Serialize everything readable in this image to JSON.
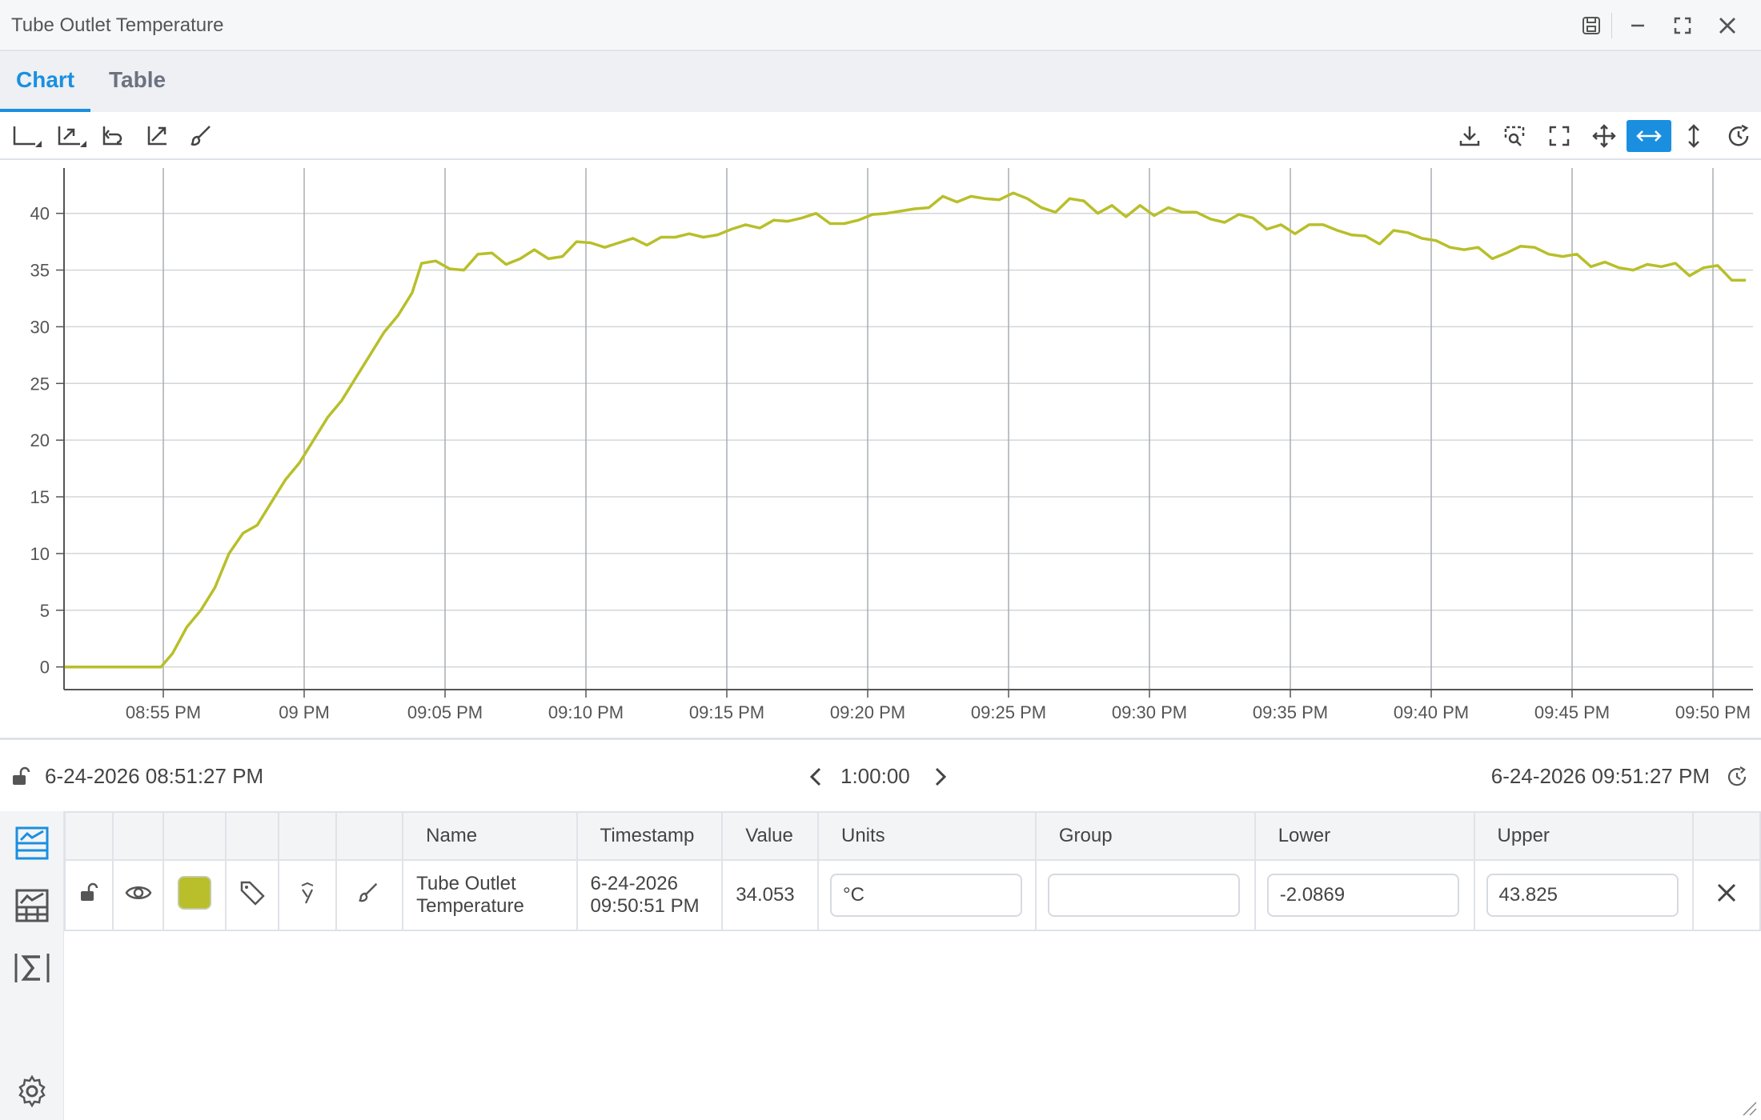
{
  "window": {
    "title": "Tube Outlet Temperature",
    "icons": [
      "save-icon",
      "minimize-icon",
      "maximize-icon",
      "close-icon"
    ]
  },
  "tabs": [
    {
      "label": "Chart",
      "active": true
    },
    {
      "label": "Table",
      "active": false
    }
  ],
  "toolbar": {
    "left_icons": [
      "axis-icon",
      "axis-scale-icon",
      "undo-zoom-icon",
      "autoscale-icon",
      "brush-icon"
    ],
    "right_icons": [
      "download-icon",
      "zoom-select-icon",
      "fullscreen-icon",
      "pan-icon",
      "horizontal-zoom-icon",
      "vertical-zoom-icon",
      "history-icon"
    ],
    "active_icon": "horizontal-zoom-icon"
  },
  "chart_data": {
    "type": "line",
    "title": "",
    "xlabel": "",
    "ylabel": "",
    "ylim": [
      -2,
      44
    ],
    "yticks": [
      0,
      5,
      10,
      15,
      20,
      25,
      30,
      35,
      40
    ],
    "xticks": [
      "08:55 PM",
      "09 PM",
      "09:05 PM",
      "09:10 PM",
      "09:15 PM",
      "09:20 PM",
      "09:25 PM",
      "09:30 PM",
      "09:35 PM",
      "09:40 PM",
      "09:45 PM",
      "09:50 PM"
    ],
    "grid": true,
    "color": "#b8bf2a",
    "series": [
      {
        "x": [
          "08:51:30 PM",
          "08:52 PM",
          "08:53 PM",
          "08:54 PM",
          "08:54:55 PM",
          "08:55:20 PM",
          "08:55:50 PM",
          "08:56:20 PM",
          "08:56:50 PM",
          "08:57:20 PM",
          "08:57:50 PM",
          "08:58:20 PM",
          "08:58:50 PM",
          "08:59:20 PM",
          "08:59:50 PM",
          "09:00:20 PM",
          "09:00:50 PM",
          "09:01:20 PM",
          "09:01:50 PM",
          "09:02:20 PM",
          "09:02:50 PM",
          "09:03:20 PM",
          "09:03:50 PM",
          "09:04:10 PM",
          "09:04:40 PM",
          "09:05:10 PM",
          "09:05:40 PM",
          "09:06:10 PM",
          "09:06:40 PM",
          "09:07:10 PM",
          "09:07:40 PM",
          "09:08:10 PM",
          "09:08:40 PM",
          "09:09:10 PM",
          "09:09:40 PM",
          "09:10:10 PM",
          "09:10:40 PM",
          "09:11:10 PM",
          "09:11:40 PM",
          "09:12:10 PM",
          "09:12:40 PM",
          "09:13:10 PM",
          "09:13:40 PM",
          "09:14:10 PM",
          "09:14:40 PM",
          "09:15:10 PM",
          "09:15:40 PM",
          "09:16:10 PM",
          "09:16:40 PM",
          "09:17:10 PM",
          "09:17:40 PM",
          "09:18:10 PM",
          "09:18:40 PM",
          "09:19:10 PM",
          "09:19:40 PM",
          "09:20:10 PM",
          "09:20:40 PM",
          "09:21:10 PM",
          "09:21:40 PM",
          "09:22:10 PM",
          "09:22:40 PM",
          "09:23:10 PM",
          "09:23:40 PM",
          "09:24:10 PM",
          "09:24:40 PM",
          "09:25:10 PM",
          "09:25:40 PM",
          "09:26:10 PM",
          "09:26:40 PM",
          "09:27:10 PM",
          "09:27:40 PM",
          "09:28:10 PM",
          "09:28:40 PM",
          "09:29:10 PM",
          "09:29:40 PM",
          "09:30:10 PM",
          "09:30:40 PM",
          "09:31:10 PM",
          "09:31:40 PM",
          "09:32:10 PM",
          "09:32:40 PM",
          "09:33:10 PM",
          "09:33:40 PM",
          "09:34:10 PM",
          "09:34:40 PM",
          "09:35:10 PM",
          "09:35:40 PM",
          "09:36:10 PM",
          "09:36:40 PM",
          "09:37:10 PM",
          "09:37:40 PM",
          "09:38:10 PM",
          "09:38:40 PM",
          "09:39:10 PM",
          "09:39:40 PM",
          "09:40:10 PM",
          "09:40:40 PM",
          "09:41:10 PM",
          "09:41:40 PM",
          "09:42:10 PM",
          "09:42:40 PM",
          "09:43:10 PM",
          "09:43:40 PM",
          "09:44:10 PM",
          "09:44:40 PM",
          "09:45:10 PM",
          "09:45:40 PM",
          "09:46:10 PM",
          "09:46:40 PM",
          "09:47:10 PM",
          "09:47:40 PM",
          "09:48:10 PM",
          "09:48:40 PM",
          "09:49:10 PM",
          "09:49:40 PM",
          "09:50:10 PM",
          "09:50:40 PM",
          "09:51:10 PM"
        ],
        "values": [
          0,
          0,
          0,
          0,
          0,
          1.2,
          3.5,
          5,
          7,
          10,
          11.8,
          12.5,
          14.5,
          16.5,
          18,
          20,
          22,
          23.5,
          25.5,
          27.5,
          29.5,
          31,
          33,
          35.6,
          35.8,
          35.1,
          35,
          36.4,
          36.5,
          35.5,
          36,
          36.8,
          36,
          36.2,
          37.5,
          37.4,
          37,
          37.4,
          37.8,
          37.2,
          37.9,
          37.9,
          38.2,
          37.9,
          38.1,
          38.6,
          39,
          38.7,
          39.4,
          39.3,
          39.6,
          40,
          39.1,
          39.1,
          39.4,
          39.9,
          40,
          40.2,
          40.4,
          40.5,
          41.5,
          41,
          41.5,
          41.3,
          41.2,
          41.8,
          41.3,
          40.5,
          40.1,
          41.3,
          41.1,
          40,
          40.7,
          39.7,
          40.7,
          39.8,
          40.5,
          40.1,
          40.1,
          39.5,
          39.2,
          39.9,
          39.6,
          38.6,
          39,
          38.2,
          39,
          39,
          38.5,
          38.1,
          38,
          37.3,
          38.5,
          38.3,
          37.8,
          37.6,
          37,
          36.8,
          37,
          36,
          36.5,
          37.1,
          37,
          36.4,
          36.2,
          36.4,
          35.3,
          35.7,
          35.2,
          35,
          35.5,
          35.3,
          35.6,
          34.5,
          35.2,
          35.4,
          34.1,
          34.1
        ]
      }
    ]
  },
  "range": {
    "start": "6-24-2026 08:51:27 PM",
    "duration": "1:00:00",
    "end": "6-24-2026 09:51:27 PM"
  },
  "table": {
    "headers": [
      "Name",
      "Timestamp",
      "Value",
      "Units",
      "Group",
      "Lower",
      "Upper"
    ],
    "row": {
      "name_line1": "Tube Outlet",
      "name_line2": "Temperature",
      "timestamp_line1": "6-24-2026",
      "timestamp_line2": "09:50:51 PM",
      "value": "34.053",
      "units": "°C",
      "group": "",
      "lower": "-2.0869",
      "upper": "43.825",
      "swatch_color": "#b8bf2a"
    }
  },
  "sidebar": {
    "icons": [
      "trend-list-icon",
      "chart-grid-icon",
      "sigma-icon",
      "settings-icon"
    ]
  }
}
